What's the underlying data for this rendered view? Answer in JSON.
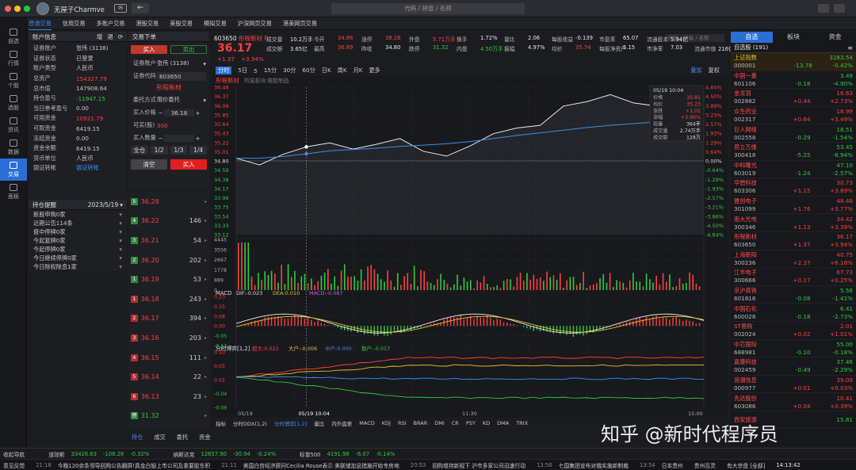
{
  "app": {
    "title": "无屋子Charmve",
    "search_placeholder": "代码 / 拼音 / 名称"
  },
  "topnav": [
    "普通交易",
    "信用交易",
    "多账户交易",
    "港股交易",
    "美股交易",
    "模拟交易",
    "沪深网页交易",
    "港美网页交易"
  ],
  "leftnav": [
    {
      "label": "自选"
    },
    {
      "label": "行情"
    },
    {
      "label": "个股"
    },
    {
      "label": "选股"
    },
    {
      "label": "资讯"
    },
    {
      "label": "数据"
    },
    {
      "label": "交易",
      "active": true
    },
    {
      "label": "面板"
    }
  ],
  "account": {
    "title": "账户信息",
    "actions": [
      "增",
      "退"
    ],
    "rows": [
      [
        "证券账户",
        "张伟 (3138)",
        ""
      ],
      [
        "证券状态",
        "已登录",
        ""
      ],
      [
        "账户类型",
        "人民币",
        ""
      ],
      [
        "总资产",
        "154327.79",
        "red"
      ],
      [
        "总市值",
        "147908.64",
        ""
      ],
      [
        "持仓盈亏",
        "-11947.15",
        "grn"
      ],
      [
        "当日参考盈亏",
        "0.00",
        ""
      ],
      [
        "可用资金",
        "10921.79",
        "red"
      ],
      [
        "可取资金",
        "6419.15",
        ""
      ],
      [
        "冻结资金",
        "0.00",
        ""
      ],
      [
        "资金余额",
        "6419.15",
        ""
      ],
      [
        "货币单位",
        "人民币",
        ""
      ],
      [
        "银证转帐",
        "银证转帐",
        "blu"
      ]
    ]
  },
  "reminder": {
    "title": "持仓提醒",
    "date": "2023/5/19",
    "items": [
      "新股申购0家",
      "近期公告114条",
      "盘中停牌0家",
      "今起复牌0家",
      "今起停牌0家",
      "今日继续停牌0家",
      "今日除权除息1家"
    ]
  },
  "order": {
    "title": "交易下单",
    "buy_tab": "买入",
    "sell_tab": "卖出",
    "acct_label": "证券账户",
    "acct_value": "张伟 (3138)",
    "code_label": "证券代码",
    "code_value": "603650",
    "stock_name": "彤程新材",
    "entrust_label": "委托方式",
    "entrust_value": "限价委托",
    "price_label": "买入价格",
    "price_value": "36.18",
    "canbuy_label": "可买(股)",
    "canbuy_value": "300",
    "qty_label": "买入数量",
    "qty_btns": [
      "全仓",
      "1/2",
      "1/3",
      "1/4"
    ],
    "clear_btn": "清空",
    "buy_btn": "买入"
  },
  "book": [
    [
      "卖5",
      "36.28",
      ""
    ],
    [
      "卖4",
      "36.22",
      "146"
    ],
    [
      "卖3",
      "36.21",
      "54"
    ],
    [
      "卖2",
      "36.20",
      "202"
    ],
    [
      "卖1",
      "36.19",
      "53"
    ],
    [
      "买1",
      "36.18",
      "243"
    ],
    [
      "买2",
      "36.17",
      "394"
    ],
    [
      "买3",
      "36.16",
      "203"
    ],
    [
      "买4",
      "36.15",
      "111"
    ],
    [
      "买5",
      "36.14",
      "22"
    ],
    [
      "买6",
      "36.13",
      "23"
    ],
    [
      "停",
      "31.32",
      ""
    ]
  ],
  "book_marks": [
    "5",
    "4",
    "3",
    "2",
    "1",
    "1",
    "2",
    "3",
    "4",
    "5",
    "6",
    "停"
  ],
  "book_tabs": [
    "持仓",
    "成交",
    "委托",
    "资金"
  ],
  "quote": {
    "code": "603650",
    "name": "彤程新材 R",
    "price": "36.17",
    "change": "+1.37",
    "pct": "+3.94%",
    "fields": [
      [
        "成交量",
        "10.2万手",
        "今开",
        "34.86",
        "涨停",
        "38.28",
        "外盘",
        "5.71万手",
        "换手",
        "1.72%",
        "量比",
        "2.06",
        "每股收益",
        "-0.139",
        "市盈率",
        "65.07",
        "流通股本",
        "5.94亿"
      ],
      [
        "成交额",
        "3.65亿",
        "最高",
        "36.89",
        "昨收",
        "34.80",
        "跌停",
        "31.32",
        "内盘",
        "4.50万手",
        "振幅",
        "4.97%",
        "均价",
        "35.74",
        "每股净资产",
        "5.15",
        "市净率",
        "7.03",
        "流通市值",
        "216亿元"
      ]
    ]
  },
  "chart_tabs": [
    "分时",
    "5日",
    "5",
    "15分",
    "30分",
    "60分",
    "日K",
    "周K",
    "月K",
    "更多"
  ],
  "chart_tools": [
    "叠加",
    "复权"
  ],
  "stock_search_placeholder": "代码 / 拼音 / 名称",
  "chart_header": {
    "name": "彤程新材",
    "sub": "所属板块:橡胶制品"
  },
  "tooltip": {
    "time": "05/19 10:04",
    "rows": [
      [
        "价格",
        "35.81"
      ],
      [
        "均价",
        "35.23"
      ],
      [
        "涨跌",
        "+1.01"
      ],
      [
        "涨幅",
        "+2.90%"
      ],
      [
        "现量",
        "364手"
      ],
      [
        "成交量",
        "2.74万手"
      ],
      [
        "成交额",
        "128万"
      ]
    ]
  },
  "chart_data": [
    {
      "type": "line",
      "title": "分时",
      "series": [
        {
          "name": "价格",
          "color": "#e8e8e8"
        },
        {
          "name": "均价",
          "color": "#3b8eea"
        }
      ],
      "ylim": [
        33.12,
        36.48
      ],
      "prev_close": 34.8,
      "price_ticks": [
        "36.48",
        "36.37",
        "36.06",
        "35.85",
        "35.64",
        "35.43",
        "35.22",
        "35.01",
        "34.80",
        "34.59",
        "34.38",
        "34.17",
        "33.96",
        "33.75",
        "33.54",
        "33.33",
        "33.12"
      ],
      "pct_ticks": [
        "4.84%",
        "4.50%",
        "3.89%",
        "3.23%",
        "2.57%",
        "1.93%",
        "1.29%",
        "0.64%",
        "0.00%",
        "-0.64%",
        "-1.29%",
        "-1.93%",
        "-2.57%",
        "-3.21%",
        "-3.86%",
        "-4.50%",
        "-4.84%"
      ],
      "x": [
        "09:30",
        "10:00",
        "10:30",
        "11:30",
        "13:30",
        "14:00",
        "14:30",
        "15:00"
      ],
      "price": [
        34.86,
        34.71,
        34.95,
        35.12,
        35.21,
        35.07,
        35.18,
        35.31,
        35.02,
        34.91,
        35.14,
        35.42,
        35.55,
        35.61,
        36.05,
        36.15,
        36.31,
        36.12,
        36.05,
        36.22,
        36.17
      ],
      "avg": [
        34.86,
        34.86,
        34.9,
        34.96,
        35.03,
        35.06,
        35.09,
        35.13,
        35.16,
        35.19,
        35.24,
        35.31,
        35.38,
        35.44,
        35.5,
        35.56,
        35.61,
        35.65,
        35.69,
        35.72,
        35.74
      ],
      "volume_ticks": [
        "4445",
        "3556",
        "2667",
        "1778",
        "889",
        "0"
      ],
      "x_axis": [
        "05/19",
        "05/19 10:04",
        "11:30",
        "15:00"
      ]
    },
    {
      "type": "bar",
      "title": "MACD",
      "labels": [
        "DIF:-0.023",
        "DEA:0.010",
        "MACD:-0.067"
      ],
      "ticks": [
        "0.23",
        "0.15",
        "0.08",
        "0.00",
        "-0.05",
        "-0.12"
      ]
    },
    {
      "type": "line",
      "title": "分时博弈[1,2]",
      "labels": [
        "超大:0.022",
        "大户:-0.006",
        "中户:0.000",
        "散户:-0.017"
      ],
      "ticks": [
        "0.10",
        "0.05",
        "0.01",
        "-0.04",
        "-0.09"
      ]
    }
  ],
  "indicator_tabs": [
    "指标",
    "分时DDX(1,2)",
    "分时博弈[1,2]",
    "量比",
    "内外盘差",
    "MACD",
    "KDJ",
    "RSI",
    "BRAR",
    "DMI",
    "CR",
    "PSY",
    "KD",
    "DMA",
    "TRIX"
  ],
  "watch": {
    "tabs": [
      "自选",
      "板块",
      "资金"
    ],
    "title": "自选股 (191)",
    "items": [
      [
        "上证指数",
        "000001",
        "-13.78",
        "-0.42%",
        "3283.54"
      ],
      [
        "中国一重",
        "601106",
        "-0.18",
        "-4.90%",
        "3.49"
      ],
      [
        "金龙羽",
        "002882",
        "+0.44",
        "+2.73%",
        "16.63"
      ],
      [
        "众生药业",
        "002317",
        "+0.64",
        "+3.49%",
        "18.99"
      ],
      [
        "巨人网络",
        "002558",
        "-0.29",
        "-1.54%",
        "18.51"
      ],
      [
        "昂立万维",
        "300418",
        "-5.25",
        "-8.94%",
        "53.45"
      ],
      [
        "中科曙光",
        "603019",
        "-1.24",
        "-2.57%",
        "47.10"
      ],
      [
        "华懋科技",
        "603306",
        "+1.15",
        "+3.89%",
        "30.73"
      ],
      [
        "雅创电子",
        "301099",
        "+1.76",
        "+3.77%",
        "48.48"
      ],
      [
        "南大光电",
        "300346",
        "+1.13",
        "+3.39%",
        "34.42"
      ],
      [
        "彤程新材",
        "603650",
        "+1.37",
        "+3.94%",
        "36.17"
      ],
      [
        "上海新阳",
        "300236",
        "+2.37",
        "+6.18%",
        "40.75"
      ],
      [
        "江丰电子",
        "300666",
        "+0.17",
        "+0.25%",
        "67.73"
      ],
      [
        "京沪高铁",
        "601816",
        "-0.08",
        "-1.41%",
        "5.58"
      ],
      [
        "中国石化",
        "600028",
        "-0.18",
        "-2.73%",
        "6.41"
      ],
      [
        "ST易购",
        "002024",
        "+0.02",
        "+1.01%",
        "2.01"
      ],
      [
        "中芯国际",
        "688981",
        "-0.10",
        "-0.18%",
        "55.00"
      ],
      [
        "嘉康科技",
        "002459",
        "-0.49",
        "-2.29%",
        "37.46"
      ],
      [
        "浪潮信息",
        "000977",
        "+0.01",
        "+0.03%",
        "39.09"
      ],
      [
        "先达股份",
        "603086",
        "+0.04",
        "+0.39%",
        "10.41"
      ],
      [
        "西安旅游",
        "",
        "",
        "",
        "15.81"
      ]
    ]
  },
  "status1": {
    "label": "收起导航",
    "items": [
      [
        "道琼斯",
        "33426.63",
        "-108.28",
        "-0.32%",
        "grn"
      ],
      [
        "纳斯达克",
        "12657.90",
        "-30.94",
        "-0.24%",
        "grn"
      ],
      [
        "标普500",
        "4191.98",
        "-6.07",
        "-0.14%",
        "grn"
      ]
    ]
  },
  "status2": {
    "label": "意见反馈",
    "news": [
      [
        "21:18",
        "今晚120余条领导回购公告翻屏!真金白银上市公司及重要股东积"
      ],
      [
        "21:11",
        "美国白宫经济顾问Cecilia Rouse表示 美联储加息措施开始专房地"
      ],
      [
        "20:53",
        "回购增持新规下 沪市多家公司迅速行动"
      ],
      [
        "13:56",
        "七国集团宣布对俄实施新制裁"
      ],
      [
        "13:54",
        "日本贵州"
      ]
    ],
    "right": [
      "贵州百灵",
      "有大宗盘 [全部]"
    ],
    "time": "14:13:42"
  },
  "watermark": "知乎 @新时代程序员"
}
